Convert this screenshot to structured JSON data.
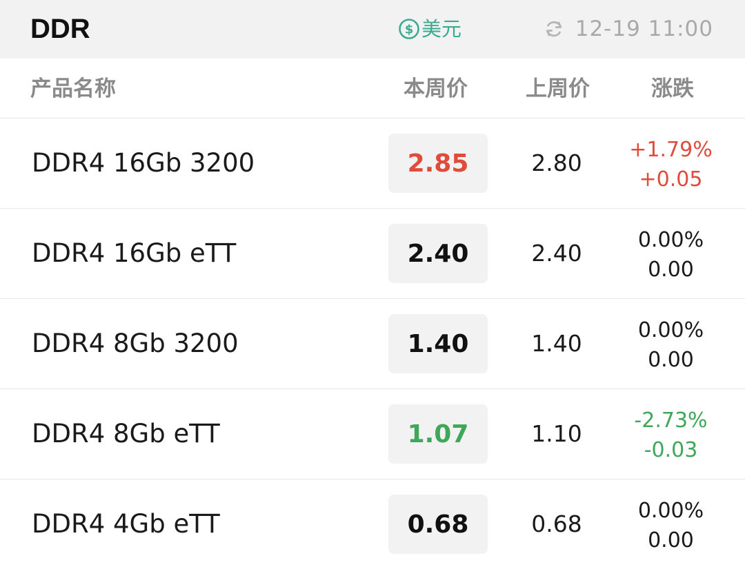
{
  "header": {
    "title": "DDR",
    "currency_label": "美元",
    "update_time": "12-19 11:00"
  },
  "columns": {
    "name": "产品名称",
    "this_week": "本周价",
    "last_week": "上周价",
    "change": "涨跌"
  },
  "colors": {
    "accent": "#3bab8f",
    "up": "#e04b3c",
    "down": "#3ea75a",
    "neutral": "#1a1a1a"
  },
  "rows": [
    {
      "name": "DDR4 16Gb 3200",
      "this_week": "2.85",
      "last_week": "2.80",
      "change_pct": "+1.79%",
      "change_abs": "+0.05",
      "trend": "up"
    },
    {
      "name": "DDR4 16Gb eTT",
      "this_week": "2.40",
      "last_week": "2.40",
      "change_pct": "0.00%",
      "change_abs": "0.00",
      "trend": "flat"
    },
    {
      "name": "DDR4 8Gb 3200",
      "this_week": "1.40",
      "last_week": "1.40",
      "change_pct": "0.00%",
      "change_abs": "0.00",
      "trend": "flat"
    },
    {
      "name": "DDR4 8Gb eTT",
      "this_week": "1.07",
      "last_week": "1.10",
      "change_pct": "-2.73%",
      "change_abs": "-0.03",
      "trend": "down"
    },
    {
      "name": "DDR4 4Gb eTT",
      "this_week": "0.68",
      "last_week": "0.68",
      "change_pct": "0.00%",
      "change_abs": "0.00",
      "trend": "flat"
    }
  ]
}
